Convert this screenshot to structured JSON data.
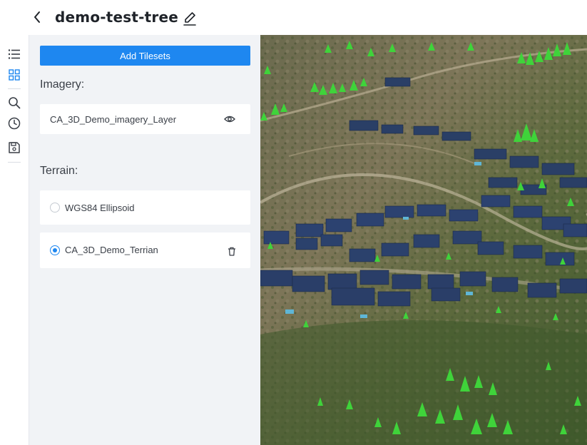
{
  "header": {
    "title": "demo-test-tree",
    "back_icon": "chevron-left-icon",
    "edit_icon": "pencil-icon"
  },
  "rail": {
    "items": [
      {
        "icon": "list-icon",
        "active": false
      },
      {
        "icon": "grid-icon",
        "active": true
      },
      {
        "icon": "search-icon",
        "active": false
      },
      {
        "icon": "clock-icon",
        "active": false
      },
      {
        "icon": "save-icon",
        "active": false
      }
    ],
    "active_color": "#1e87f0"
  },
  "panel": {
    "add_button_label": "Add Tilesets",
    "imagery_label": "Imagery:",
    "imagery_layers": [
      {
        "name": "CA_3D_Demo_imagery_Layer",
        "icon": "eye-icon"
      }
    ],
    "terrain_label": "Terrain:",
    "terrain_options": [
      {
        "name": "WGS84 Ellipsoid",
        "selected": false
      },
      {
        "name": "CA_3D_Demo_Terrian",
        "selected": true,
        "icon": "trash-icon"
      }
    ]
  },
  "colors": {
    "accent": "#1e87f0",
    "panel_bg": "#f1f3f6",
    "card_bg": "#ffffff"
  }
}
